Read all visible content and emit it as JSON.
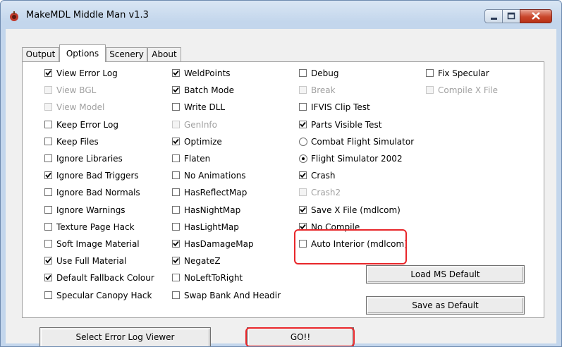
{
  "window": {
    "title": "MakeMDL Middle Man v1.3"
  },
  "tabs": [
    {
      "label": "Output",
      "active": false
    },
    {
      "label": "Options",
      "active": true
    },
    {
      "label": "Scenery",
      "active": false
    },
    {
      "label": "About",
      "active": false
    }
  ],
  "options": {
    "col1": [
      {
        "label": "View Error Log",
        "checked": true,
        "enabled": true
      },
      {
        "label": "View BGL",
        "checked": false,
        "enabled": false
      },
      {
        "label": "View Model",
        "checked": false,
        "enabled": false
      },
      {
        "label": "Keep Error Log",
        "checked": false,
        "enabled": true
      },
      {
        "label": "Keep Files",
        "checked": false,
        "enabled": true
      },
      {
        "label": "Ignore Libraries",
        "checked": false,
        "enabled": true
      },
      {
        "label": "Ignore Bad Triggers",
        "checked": true,
        "enabled": true
      },
      {
        "label": "Ignore Bad Normals",
        "checked": false,
        "enabled": true
      },
      {
        "label": "Ignore Warnings",
        "checked": false,
        "enabled": true
      },
      {
        "label": "Texture Page Hack",
        "checked": false,
        "enabled": true
      },
      {
        "label": "Soft Image Material",
        "checked": false,
        "enabled": true
      },
      {
        "label": "Use Full Material",
        "checked": true,
        "enabled": true
      },
      {
        "label": "Default Fallback Colour",
        "checked": true,
        "enabled": true
      },
      {
        "label": "Specular Canopy Hack",
        "checked": false,
        "enabled": true
      }
    ],
    "col2": [
      {
        "label": "WeldPoints",
        "checked": true,
        "enabled": true
      },
      {
        "label": "Batch Mode",
        "checked": true,
        "enabled": true
      },
      {
        "label": "Write DLL",
        "checked": false,
        "enabled": true
      },
      {
        "label": "GenInfo",
        "checked": false,
        "enabled": false
      },
      {
        "label": "Optimize",
        "checked": true,
        "enabled": true
      },
      {
        "label": "Flaten",
        "checked": false,
        "enabled": true
      },
      {
        "label": "No Animations",
        "checked": false,
        "enabled": true
      },
      {
        "label": "HasReflectMap",
        "checked": false,
        "enabled": true
      },
      {
        "label": "HasNightMap",
        "checked": false,
        "enabled": true
      },
      {
        "label": "HasLightMap",
        "checked": false,
        "enabled": true
      },
      {
        "label": "HasDamageMap",
        "checked": true,
        "enabled": true
      },
      {
        "label": "NegateZ",
        "checked": true,
        "enabled": true
      },
      {
        "label": "NoLeftToRight",
        "checked": false,
        "enabled": true
      },
      {
        "label": "Swap Bank And Headir",
        "checked": false,
        "enabled": true
      }
    ],
    "col3": [
      {
        "label": "Debug",
        "checked": false,
        "enabled": true,
        "kind": "check"
      },
      {
        "label": "Break",
        "checked": false,
        "enabled": false,
        "kind": "check"
      },
      {
        "label": "IFVIS Clip Test",
        "checked": false,
        "enabled": true,
        "kind": "check"
      },
      {
        "label": "Parts Visible Test",
        "checked": true,
        "enabled": true,
        "kind": "check"
      },
      {
        "label": "Combat Flight Simulator",
        "checked": false,
        "enabled": true,
        "kind": "radio"
      },
      {
        "label": "Flight Simulator 2002",
        "checked": true,
        "enabled": true,
        "kind": "radio"
      },
      {
        "label": "Crash",
        "checked": true,
        "enabled": true,
        "kind": "check"
      },
      {
        "label": "Crash2",
        "checked": false,
        "enabled": false,
        "kind": "check"
      },
      {
        "label": "Save X File  (mdlcom)",
        "checked": true,
        "enabled": true,
        "kind": "check"
      },
      {
        "label": "No Compile",
        "checked": true,
        "enabled": true,
        "kind": "check"
      },
      {
        "label": "Auto Interior (mdlcom)",
        "checked": false,
        "enabled": true,
        "kind": "check"
      }
    ],
    "col4": [
      {
        "label": "Fix Specular",
        "checked": false,
        "enabled": true
      },
      {
        "label": "Compile X File",
        "checked": false,
        "enabled": false
      }
    ]
  },
  "buttons": {
    "load_default": "Load MS Default",
    "save_default": "Save as Default",
    "error_viewer": "Select Error Log Viewer",
    "go": "GO!!"
  },
  "colors": {
    "highlight": "#e8262a"
  }
}
